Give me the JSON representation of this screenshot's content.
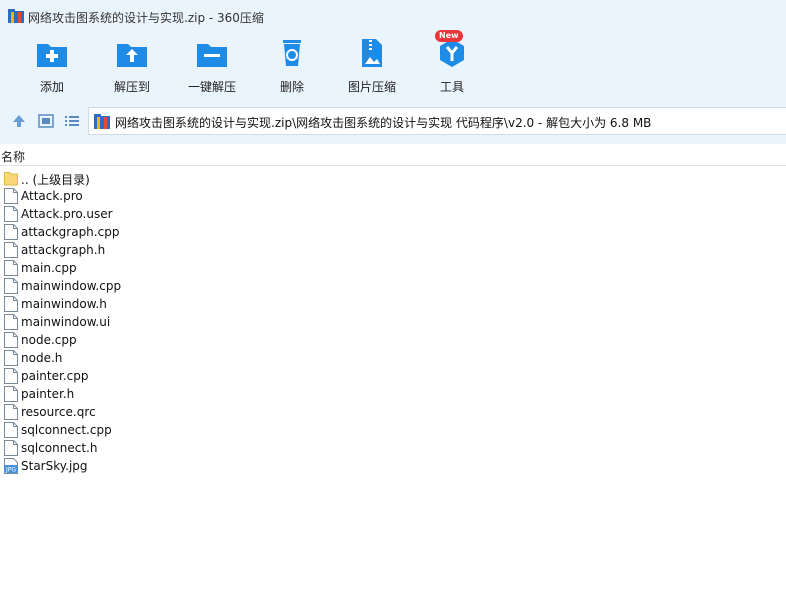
{
  "window": {
    "title": "网络攻击图系统的设计与实现.zip - 360压缩"
  },
  "toolbar": {
    "buttons": [
      {
        "label": "添加",
        "icon": "add-icon"
      },
      {
        "label": "解压到",
        "icon": "extract-to-icon"
      },
      {
        "label": "一键解压",
        "icon": "one-click-extract-icon"
      },
      {
        "label": "删除",
        "icon": "delete-icon"
      },
      {
        "label": "图片压缩",
        "icon": "image-compress-icon"
      },
      {
        "label": "工具",
        "icon": "tools-icon",
        "badge": "New"
      }
    ]
  },
  "navbar": {
    "path": "网络攻击图系统的设计与实现.zip\\网络攻击图系统的设计与实现 代码程序\\v2.0 - 解包大小为 6.8 MB"
  },
  "filelist": {
    "column_name": "名称",
    "items": [
      {
        "name": ".. (上级目录)",
        "type": "folder"
      },
      {
        "name": "Attack.pro",
        "type": "file"
      },
      {
        "name": "Attack.pro.user",
        "type": "file"
      },
      {
        "name": "attackgraph.cpp",
        "type": "file"
      },
      {
        "name": "attackgraph.h",
        "type": "file"
      },
      {
        "name": "main.cpp",
        "type": "file"
      },
      {
        "name": "mainwindow.cpp",
        "type": "file"
      },
      {
        "name": "mainwindow.h",
        "type": "file"
      },
      {
        "name": "mainwindow.ui",
        "type": "file"
      },
      {
        "name": "node.cpp",
        "type": "file"
      },
      {
        "name": "node.h",
        "type": "file"
      },
      {
        "name": "painter.cpp",
        "type": "file"
      },
      {
        "name": "painter.h",
        "type": "file"
      },
      {
        "name": "resource.qrc",
        "type": "file"
      },
      {
        "name": "sqlconnect.cpp",
        "type": "file"
      },
      {
        "name": "sqlconnect.h",
        "type": "file"
      },
      {
        "name": "StarSky.jpg",
        "type": "image",
        "badge": "JPG"
      }
    ]
  },
  "colors": {
    "accent": "#1e8be6",
    "toolbar_bg": "#eaf4fc",
    "badge_red": "#e8363a"
  }
}
